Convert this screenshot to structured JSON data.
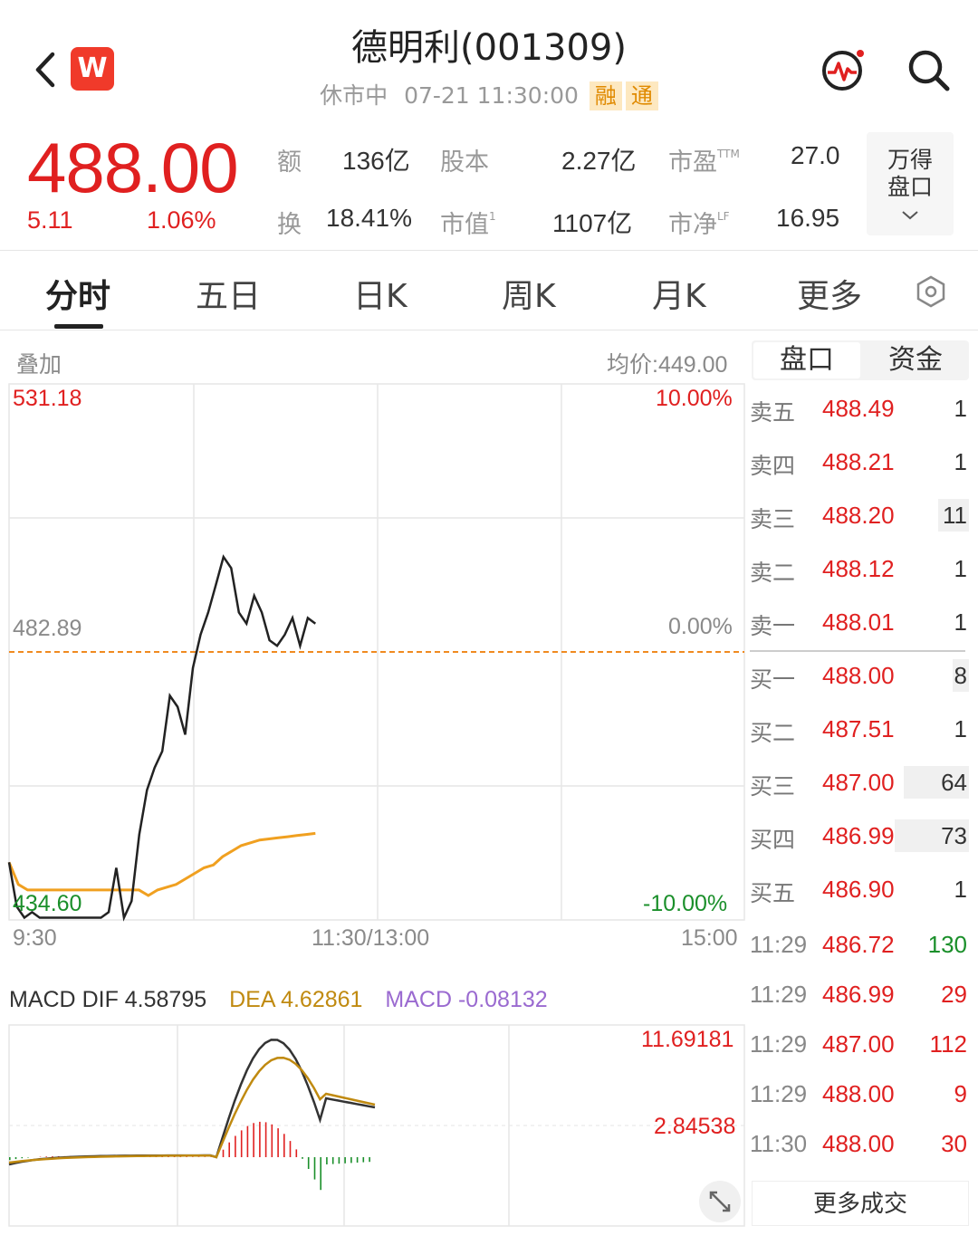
{
  "header": {
    "title": "德明利(001309)",
    "status": "休市中",
    "datetime": "07-21 11:30:00",
    "tags": [
      "融",
      "通"
    ],
    "logo_letter": "W"
  },
  "quote": {
    "price": "488.00",
    "change": "5.11",
    "change_pct": "1.06%",
    "stats": [
      {
        "label": "额",
        "value": "136亿",
        "sup": ""
      },
      {
        "label": "股本",
        "value": "2.27亿",
        "sup": ""
      },
      {
        "label": "市盈",
        "value": "27.0",
        "sup": "TTM"
      },
      {
        "label": "换",
        "value": "18.41%",
        "sup": ""
      },
      {
        "label": "市值",
        "value": "1107亿",
        "sup": "1"
      },
      {
        "label": "市净",
        "value": "16.95",
        "sup": "LF"
      }
    ],
    "wind_box": [
      "万得",
      "盘口"
    ]
  },
  "tabs": [
    "分时",
    "五日",
    "日K",
    "周K",
    "月K",
    "更多"
  ],
  "active_tab": 0,
  "intraday": {
    "overlay_label": "叠加",
    "avg_price_label": "均价:449.00",
    "high_label": "531.18",
    "mid_label": "482.89",
    "low_label": "434.60",
    "pct_high": "10.00%",
    "pct_mid": "0.00%",
    "pct_low": "-10.00%",
    "times": [
      "9:30",
      "11:30/13:00",
      "15:00"
    ]
  },
  "chart_data": {
    "type": "line",
    "title": "",
    "ylim": [
      434.6,
      531.18
    ],
    "prev_close": 482.89,
    "series": [
      {
        "values": [
          445,
          437,
          435,
          436,
          435,
          435,
          435,
          435,
          435,
          435,
          435,
          435,
          435,
          436,
          444,
          435,
          438,
          450,
          458,
          462,
          465,
          475,
          473,
          468,
          480,
          486,
          490,
          495,
          500,
          498,
          490,
          488,
          493,
          490,
          485,
          484,
          486,
          489,
          484,
          489,
          488
        ]
      },
      {
        "values": [
          445,
          441,
          440,
          440,
          440,
          440,
          440,
          440,
          440,
          440,
          440,
          440,
          440,
          440,
          440,
          439,
          440,
          440.5,
          441,
          442,
          443,
          444,
          444.5,
          446,
          447,
          448,
          448.5,
          449,
          449.2,
          449.4,
          449.6,
          449.8,
          450,
          450.2
        ]
      }
    ]
  },
  "macd": {
    "label": "MACD",
    "dif": "DIF 4.58795",
    "dea": "DEA 4.62861",
    "macd": "MACD -0.08132",
    "top_label": "11.69181",
    "mid_label": "2.84538",
    "colors": {
      "dif": "#333333",
      "dea": "#c08a10",
      "macd": "#9a6ad0"
    }
  },
  "orderbook": {
    "tabs": [
      "盘口",
      "资金"
    ],
    "asks": [
      {
        "label": "卖五",
        "price": "488.49",
        "vol": "1"
      },
      {
        "label": "卖四",
        "price": "488.21",
        "vol": "1"
      },
      {
        "label": "卖三",
        "price": "488.20",
        "vol": "11"
      },
      {
        "label": "卖二",
        "price": "488.12",
        "vol": "1"
      },
      {
        "label": "卖一",
        "price": "488.01",
        "vol": "1"
      }
    ],
    "bids": [
      {
        "label": "买一",
        "price": "488.00",
        "vol": "8"
      },
      {
        "label": "买二",
        "price": "487.51",
        "vol": "1"
      },
      {
        "label": "买三",
        "price": "487.00",
        "vol": "64"
      },
      {
        "label": "买四",
        "price": "486.99",
        "vol": "73"
      },
      {
        "label": "买五",
        "price": "486.90",
        "vol": "1"
      }
    ]
  },
  "trades": [
    {
      "time": "11:29",
      "price": "486.72",
      "vol": "130",
      "dir": "green"
    },
    {
      "time": "11:29",
      "price": "486.99",
      "vol": "29",
      "dir": "red"
    },
    {
      "time": "11:29",
      "price": "487.00",
      "vol": "112",
      "dir": "red"
    },
    {
      "time": "11:29",
      "price": "488.00",
      "vol": "9",
      "dir": "red"
    },
    {
      "time": "11:30",
      "price": "488.00",
      "vol": "30",
      "dir": "red"
    }
  ],
  "more_trades_label": "更多成交",
  "colors": {
    "up": "#e02020",
    "down": "#1a8f2a",
    "avg_line": "#f0a020",
    "accent": "#f03a2a"
  }
}
